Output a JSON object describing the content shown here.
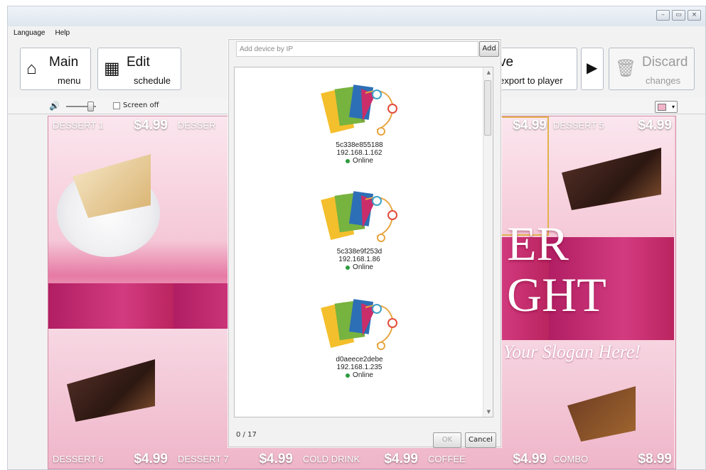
{
  "menubar": {
    "language": "Language",
    "help": "Help"
  },
  "toolbar": {
    "main": {
      "title": "Main",
      "sub": "menu",
      "icon": "home-icon"
    },
    "edit": {
      "title": "Edit",
      "sub": "schedule",
      "icon": "calendar-icon"
    },
    "save": {
      "title": "ve",
      "sub": "export to player"
    },
    "discard": {
      "title": "Discard",
      "sub": "changes",
      "icon": "trash-icon"
    }
  },
  "subbar": {
    "screen_off": "Screen off",
    "volume_icon": "speaker-icon"
  },
  "dialog": {
    "ip_placeholder": "Add device by IP",
    "add": "Add",
    "count": "0 / 17",
    "ok": "OK",
    "cancel": "Cancel",
    "devices": [
      {
        "id": "5c338e855188",
        "ip": "192.168.1.162",
        "status": "Online"
      },
      {
        "id": "5c338e9f253d",
        "ip": "192.168.1.86",
        "status": "Online"
      },
      {
        "id": "d0aeece2debe",
        "ip": "192.168.1.235",
        "status": "Online"
      }
    ]
  },
  "menu_board": {
    "top": [
      {
        "name": "DESSERT 1",
        "price": "$4.99"
      },
      {
        "name": "DESSER",
        "price": ""
      },
      {
        "name": "",
        "price": "$4.99"
      },
      {
        "name": "DESSERT 5",
        "price": "$4.99"
      }
    ],
    "bottom": [
      {
        "name": "DESSERT 6",
        "price": "$4.99"
      },
      {
        "name": "DESSERT 7",
        "price": "$4.99"
      },
      {
        "name": "COLD DRINK",
        "price": "$4.99"
      },
      {
        "name": "COFFEE",
        "price": "$4.99"
      },
      {
        "name": "COMBO",
        "price": "$8.99"
      }
    ],
    "banner_line1": "ER",
    "banner_line2": "GHT",
    "slogan": "Your Slogan Here!"
  },
  "colors": {
    "accent_pink": "#d33b80",
    "online_green": "#2e9b3e"
  }
}
